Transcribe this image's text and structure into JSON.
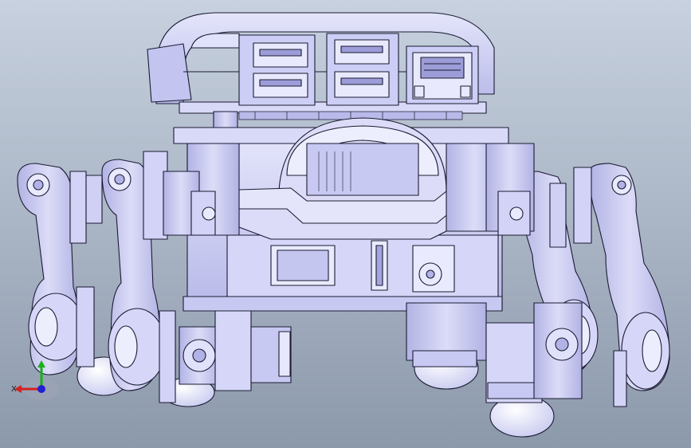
{
  "viewport": {
    "background_top": "#c7d1df",
    "background_bottom": "#8c99ab",
    "model_fill": "#cfd0f4",
    "model_fill_light": "#e4e5fb",
    "model_fill_dark": "#a9aae0",
    "edge_color": "#1b1b33"
  },
  "triad": {
    "x_label": "X",
    "x_color": "#d42020",
    "y_color": "#18b018",
    "z_color": "#2020d0"
  },
  "model": {
    "name_icon": "quadruped-robot-model-icon"
  }
}
